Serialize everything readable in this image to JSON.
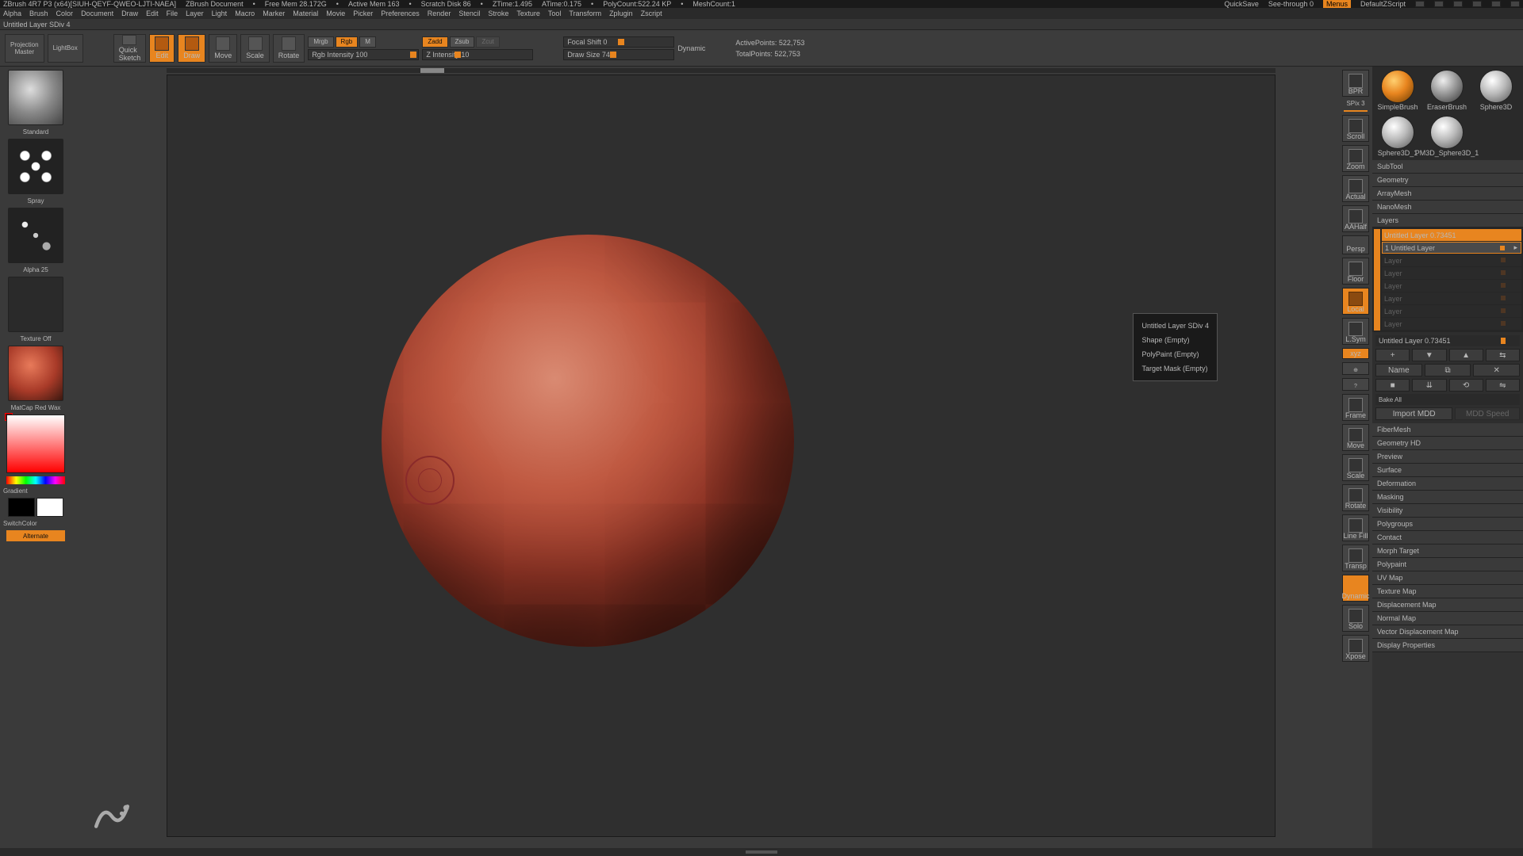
{
  "topbar": {
    "app": "ZBrush 4R7 P3 (x64)[SIUH-QEYF-QWEO-LJTI-NAEA]",
    "doc": "ZBrush Document",
    "freemem": "Free Mem 28.172G",
    "activemem": "Active Mem 163",
    "scratch": "Scratch Disk 86",
    "ztime": "ZTime:1.495",
    "atime": "ATime:0.175",
    "polycount": "PolyCount:522.24 KP",
    "meshcount": "MeshCount:1",
    "quicksave": "QuickSave",
    "seethrough": "See-through  0",
    "menus": "Menus",
    "defaultscript": "DefaultZScript"
  },
  "menubar": [
    "Alpha",
    "Brush",
    "Color",
    "Document",
    "Draw",
    "Edit",
    "File",
    "Layer",
    "Light",
    "Macro",
    "Marker",
    "Material",
    "Movie",
    "Picker",
    "Preferences",
    "Render",
    "Stencil",
    "Stroke",
    "Texture",
    "Tool",
    "Transform",
    "Zplugin",
    "Zscript"
  ],
  "status": "Untitled Layer SDiv 4",
  "toolbar": {
    "projection": "Projection\nMaster",
    "lightbox": "LightBox",
    "quicksketch": "Quick\nSketch",
    "edit": "Edit",
    "draw": "Draw",
    "move": "Move",
    "scale": "Scale",
    "rotate": "Rotate",
    "mrgb": "Mrgb",
    "rgb": "Rgb",
    "m": "M",
    "rgb_intensity": "Rgb Intensity 100",
    "zadd": "Zadd",
    "zsub": "Zsub",
    "zcut": "Zcut",
    "z_intensity": "Z Intensity 10",
    "focal": "Focal Shift 0",
    "drawsize": "Draw Size 74",
    "dynamic": "Dynamic",
    "active": "ActivePoints: 522,753",
    "total": "TotalPoints: 522,753"
  },
  "left": {
    "brush": "Standard",
    "stroke": "Spray",
    "alpha": "Alpha 25",
    "texture": "Texture Off",
    "material": "MatCap Red Wax",
    "gradient": "Gradient",
    "switchcolor": "SwitchColor",
    "alternate": "Alternate"
  },
  "rv": {
    "bpr": "BPR",
    "spix": "SPix 3",
    "scroll": "Scroll",
    "zoom": "Zoom",
    "actual": "Actual",
    "aahalf": "AAHalf",
    "persp": "Persp",
    "floor": "Floor",
    "local": "Local",
    "lsym": "L.Sym",
    "xyz": "xyz",
    "frame": "Frame",
    "move": "Move",
    "scale": "Scale",
    "rotate": "Rotate",
    "linefill": "Line Fill",
    "transp": "Transp",
    "dynamic": "Dynamic",
    "solo": "Solo",
    "xpose": "Xpose"
  },
  "tooltip": {
    "l1": "Untitled Layer SDiv 4",
    "l2": "Shape (Empty)",
    "l3": "PolyPaint (Empty)",
    "l4": "Target Mask (Empty)"
  },
  "tools": {
    "t1": "SimpleBrush",
    "t2": "EraserBrush",
    "t3": "Sphere3D",
    "t4": "Sphere3D_1",
    "t5": "PM3D_Sphere3D_1"
  },
  "sections": {
    "subtool": "SubTool",
    "geometry": "Geometry",
    "arraymesh": "ArrayMesh",
    "nanomesh": "NanoMesh",
    "layers": "Layers",
    "fibermesh": "FiberMesh",
    "geometryhd": "Geometry HD",
    "preview": "Preview",
    "surface": "Surface",
    "deformation": "Deformation",
    "masking": "Masking",
    "visibility": "Visibility",
    "polygroups": "Polygroups",
    "contact": "Contact",
    "morph": "Morph Target",
    "polypaint": "Polypaint",
    "uvmap": "UV Map",
    "texmap": "Texture Map",
    "dispmap": "Displacement Map",
    "normmap": "Normal Map",
    "vdispmap": "Vector Displacement Map",
    "dispprops": "Display Properties"
  },
  "layers": {
    "row1": "Untitled Layer 0.73451",
    "row2": "1 Untitled Layer",
    "rows_blank": "Layer",
    "slider": "Untitled Layer 0.73451",
    "name": "Name",
    "bake": "Bake All",
    "import": "Import MDD",
    "mddspeed": "MDD Speed"
  }
}
